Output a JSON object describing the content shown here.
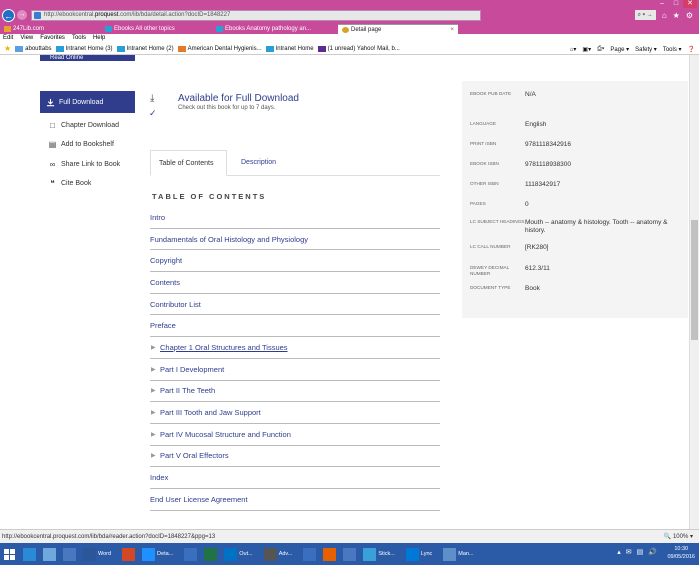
{
  "browser": {
    "url_prefix": "http://ebookcentral.",
    "url_domain": "proquest",
    "url_suffix": ".com/lib/bda/detail.action?docID=1848227",
    "search_placeholder": "⌕ ▾ →",
    "window_controls": {
      "minimize": "–",
      "maximize": "□",
      "close": "✕"
    },
    "tabs": [
      {
        "label": "247Lib.com",
        "active": false
      },
      {
        "label": "Ebooks All other topics",
        "active": false
      },
      {
        "label": "Ebooks Anatomy pathology an...",
        "active": false
      },
      {
        "label": "Detail page",
        "active": true
      }
    ],
    "menu": [
      "Edit",
      "View",
      "Favorites",
      "Tools",
      "Help"
    ],
    "favorites": [
      {
        "label": "abouttabs",
        "color": "#5aa0e0"
      },
      {
        "label": "Intranet Home (3)",
        "color": "#2a9fd6"
      },
      {
        "label": "Intranet Home (2)",
        "color": "#2a9fd6"
      },
      {
        "label": "American Dental Hygienis...",
        "color": "#e6782a"
      },
      {
        "label": "Intranet Home",
        "color": "#2a9fd6"
      },
      {
        "label": "(1 unread) Yahoo! Mail, b...",
        "color": "#5c2d91"
      }
    ],
    "command_bar": [
      "Page ▾",
      "Safety ▾",
      "Tools ▾"
    ]
  },
  "sidebar": {
    "read_online": "Read Online",
    "full_download": "Full Download",
    "links": [
      {
        "label": "Chapter Download",
        "icon": "page-icon"
      },
      {
        "label": "Add to Bookshelf",
        "icon": "bookshelf-icon"
      },
      {
        "label": "Share Link to Book",
        "icon": "link-icon"
      },
      {
        "label": "Cite Book",
        "icon": "quote-icon"
      }
    ]
  },
  "availability": {
    "title": "Available for Full Download",
    "subtitle": "Check out this book for up to 7 days."
  },
  "content_tabs": {
    "toc": "Table of Contents",
    "description": "Description"
  },
  "toc": {
    "heading": "TABLE OF CONTENTS",
    "items": [
      {
        "label": "Intro",
        "expandable": false,
        "underline": false
      },
      {
        "label": "Fundamentals of Oral Histology and Physiology",
        "expandable": false,
        "underline": false
      },
      {
        "label": "Copyright",
        "expandable": false,
        "underline": false
      },
      {
        "label": "Contents",
        "expandable": false,
        "underline": false
      },
      {
        "label": "Contributor List",
        "expandable": false,
        "underline": false
      },
      {
        "label": "Preface",
        "expandable": false,
        "underline": false
      },
      {
        "label": "Chapter 1 Oral Structures and Tissues",
        "expandable": true,
        "underline": true
      },
      {
        "label": "Part I Development",
        "expandable": true,
        "underline": false
      },
      {
        "label": "Part II The Teeth",
        "expandable": true,
        "underline": false
      },
      {
        "label": "Part III Tooth and Jaw Support",
        "expandable": true,
        "underline": false
      },
      {
        "label": "Part IV Mucosal Structure and Function",
        "expandable": true,
        "underline": false
      },
      {
        "label": "Part V Oral Effectors",
        "expandable": true,
        "underline": false
      },
      {
        "label": "Index",
        "expandable": false,
        "underline": false
      },
      {
        "label": "End User License Agreement",
        "expandable": false,
        "underline": false
      }
    ]
  },
  "details": [
    {
      "label": "EBOOK PUB DATE",
      "value": "N/A"
    },
    {
      "label": "LANGUAGE",
      "value": "English"
    },
    {
      "label": "PRINT ISBN",
      "value": "9781118342916"
    },
    {
      "label": "EBOOK ISBN",
      "value": "9781118938300"
    },
    {
      "label": "OTHER ISBN",
      "value": "1118342917"
    },
    {
      "label": "PAGES",
      "value": "0"
    },
    {
      "label": "LC SUBJECT HEADINGS",
      "value": "Mouth -- anatomy & histology. Tooth -- anatomy & history."
    },
    {
      "label": "LC CALL NUMBER",
      "value": "[RK280]"
    },
    {
      "label": "DEWEY DECIMAL NUMBER",
      "value": "612.3/11"
    },
    {
      "label": "DOCUMENT TYPE",
      "value": "Book"
    }
  ],
  "status": {
    "url": "http://ebookcentral.proquest.com/lib/bda/reader.action?docID=1848227&ppg=13",
    "zoom": "🔍 100% ▾"
  },
  "taskbar": {
    "items": [
      {
        "label": "",
        "color": "#2b8ad8"
      },
      {
        "label": "",
        "color": "#6fa8dc"
      },
      {
        "label": "",
        "color": "#4a78c0"
      },
      {
        "label": "Word",
        "color": "#2b579a"
      },
      {
        "label": "",
        "color": "#d24726"
      },
      {
        "label": "Deta...",
        "color": "#1e90ff"
      },
      {
        "label": "",
        "color": "#3a6fbf"
      },
      {
        "label": "",
        "color": "#217346"
      },
      {
        "label": "Out...",
        "color": "#0072c6"
      },
      {
        "label": "Adv...",
        "color": "#555555"
      },
      {
        "label": "",
        "color": "#3a6fbf"
      },
      {
        "label": "",
        "color": "#e66000"
      },
      {
        "label": "",
        "color": "#4a78c0"
      },
      {
        "label": "Stick...",
        "color": "#3aa0d8"
      },
      {
        "label": "Lync",
        "color": "#0078d7"
      },
      {
        "label": "Man...",
        "color": "#5e8fc8"
      }
    ],
    "time": "10:30",
    "date": "09/05/2016"
  }
}
